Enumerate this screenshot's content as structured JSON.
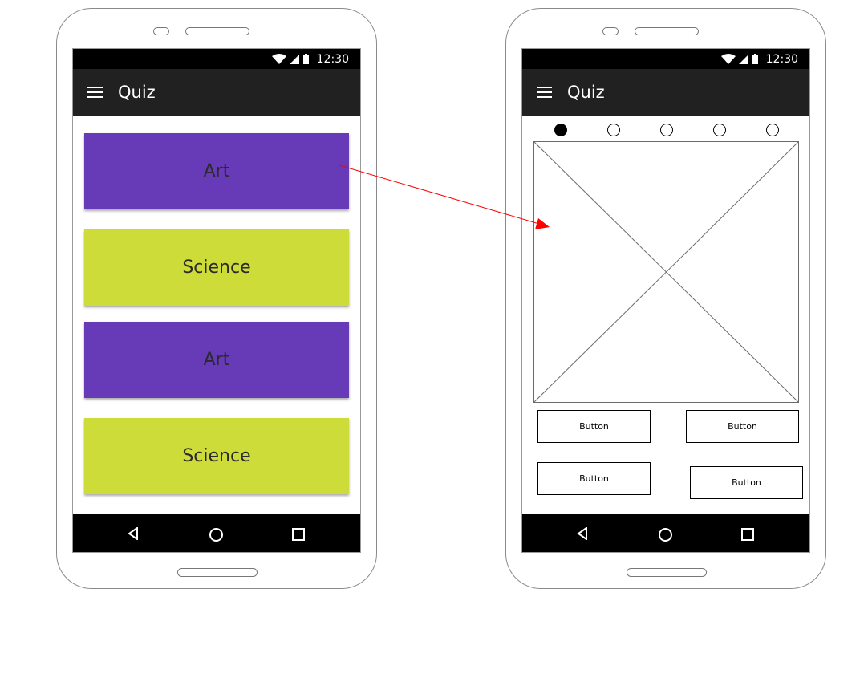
{
  "phone_left": {
    "status": {
      "time": "12:30"
    },
    "appbar": {
      "title": "Quiz"
    },
    "cards": [
      {
        "label": "Art",
        "color": "#673AB7"
      },
      {
        "label": "Science",
        "color": "#CDDC39"
      },
      {
        "label": "Art",
        "color": "#673AB7"
      },
      {
        "label": "Science",
        "color": "#CDDC39"
      }
    ]
  },
  "phone_right": {
    "status": {
      "time": "12:30"
    },
    "appbar": {
      "title": "Quiz"
    },
    "pager": {
      "active_index": 0,
      "count": 5
    },
    "buttons": [
      "Button",
      "Button",
      "Button",
      "Button"
    ]
  },
  "colors": {
    "appbar": "#212121",
    "statusbar": "#000000",
    "arrow": "#FF0000"
  },
  "icons": {
    "status": [
      "wifi-icon",
      "signal-icon",
      "battery-icon"
    ],
    "appbar": "menu-icon",
    "nav": [
      "back-icon",
      "home-icon",
      "recents-icon"
    ]
  }
}
